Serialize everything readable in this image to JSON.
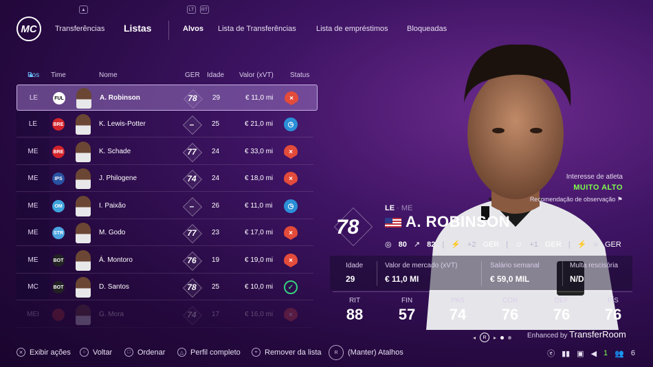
{
  "top": {
    "logo": "MC",
    "nav_main": [
      {
        "label": "Transferências"
      },
      {
        "label": "Listas"
      }
    ],
    "sub_tabs": [
      {
        "label": "Alvos",
        "active": true
      },
      {
        "label": "Lista de Transferências"
      },
      {
        "label": "Lista de empréstimos"
      },
      {
        "label": "Bloqueadas"
      }
    ],
    "controller_hints": [
      "LT",
      "RT"
    ]
  },
  "table": {
    "headers": {
      "pos": "Pos",
      "time": "Time",
      "name": "Nome",
      "ger": "GER",
      "age": "Idade",
      "value": "Valor (xVT)",
      "status": "Status"
    },
    "rows": [
      {
        "pos": "LE",
        "club": "FUL",
        "club_color": "#ffffff",
        "name": "A. Robinson",
        "ger": "78",
        "age": "29",
        "value": "€ 11,0 mi",
        "status": "red"
      },
      {
        "pos": "LE",
        "club": "BRE",
        "club_color": "#d5232b",
        "name": "K. Lewis-Potter",
        "ger": "–",
        "age": "25",
        "value": "€ 21,0 mi",
        "status": "blue"
      },
      {
        "pos": "ME",
        "club": "BRE",
        "club_color": "#d5232b",
        "name": "K. Schade",
        "ger": "77",
        "age": "24",
        "value": "€ 33,0 mi",
        "status": "red"
      },
      {
        "pos": "ME",
        "club": "IPS",
        "club_color": "#2952a3",
        "name": "J. Philogene",
        "ger": "74",
        "age": "24",
        "value": "€ 18,0 mi",
        "status": "red"
      },
      {
        "pos": "ME",
        "club": "OM",
        "club_color": "#3fa3dc",
        "name": "I. Paixão",
        "ger": "–",
        "age": "26",
        "value": "€ 11,0 mi",
        "status": "blue"
      },
      {
        "pos": "ME",
        "club": "STR",
        "club_color": "#4aa3e0",
        "name": "M. Godo",
        "ger": "77",
        "age": "23",
        "value": "€ 17,0 mi",
        "status": "person"
      },
      {
        "pos": "ME",
        "club": "BOT",
        "club_color": "#222222",
        "name": "Á. Montoro",
        "ger": "76",
        "age": "19",
        "value": "€ 19,0 mi",
        "status": "red"
      },
      {
        "pos": "MC",
        "club": "BOT",
        "club_color": "#222222",
        "name": "D. Santos",
        "ger": "78",
        "age": "25",
        "value": "€ 10,0 mi",
        "status": "green"
      },
      {
        "pos": "MEI",
        "club": "",
        "club_color": "#a33",
        "name": "G. Mora",
        "ger": "74",
        "age": "17",
        "value": "€ 16,0 mi",
        "status": "red"
      }
    ]
  },
  "player": {
    "interest_label": "Interesse de atleta",
    "interest_level": "MUITO ALTO",
    "scout_label": "Recomendação de observação",
    "overall": "78",
    "position": "LE",
    "alt_position": "· ME",
    "name": "A. ROBINSON",
    "attr1_value": "80",
    "attr2_value": "82",
    "ger_suffix": "GER",
    "ger2_prefix": "+1",
    "ger1_prefix": "+2",
    "info": [
      {
        "label": "Idade",
        "value": "29"
      },
      {
        "label": "Valor de mercado (xVT)",
        "value": "€ 11,0 MI"
      },
      {
        "label": "Salário semanal",
        "value": "€ 59,0 MIL"
      },
      {
        "label": "Multa rescisória",
        "value": "N/D"
      }
    ],
    "stats": [
      {
        "label": "RIT",
        "value": "88"
      },
      {
        "label": "FIN",
        "value": "57"
      },
      {
        "label": "PAS",
        "value": "74"
      },
      {
        "label": "CON",
        "value": "76"
      },
      {
        "label": "DEF",
        "value": "76"
      },
      {
        "label": "FÍS",
        "value": "76"
      }
    ],
    "enhanced_by": "Enhanced by",
    "transferroom": "TransferRoom"
  },
  "bottom": {
    "hints": [
      {
        "icon": "✕",
        "label": "Exibir ações"
      },
      {
        "icon": "○",
        "label": "Voltar"
      },
      {
        "icon": "□",
        "label": "Ordenar"
      },
      {
        "icon": "△",
        "label": "Perfil completo"
      },
      {
        "icon": "⌖",
        "label": "Remover da lista"
      },
      {
        "icon": "R",
        "label": "(Manter) Atalhos"
      }
    ],
    "right": {
      "count1": "1",
      "count2": "6"
    }
  },
  "colors": {
    "accent": "#7dff4a",
    "status_red": "#e34b3a",
    "status_blue": "#2b8fd8",
    "status_green": "#35d07f"
  }
}
